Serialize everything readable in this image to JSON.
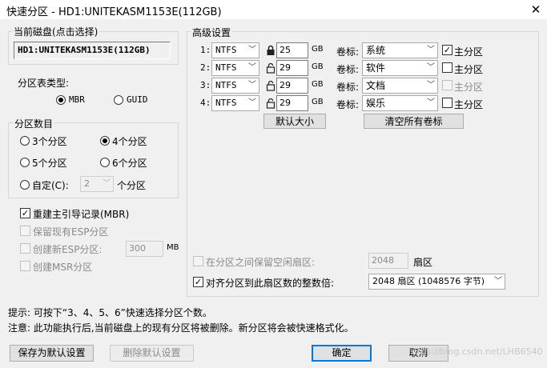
{
  "window": {
    "title": "快速分区 - HD1:UNITEKASM1153E(112GB)",
    "close_glyph": "✕"
  },
  "current_disk": {
    "group_label": "当前磁盘(点击选择)",
    "value": "HD1:UNITEKASM1153E(112GB)"
  },
  "partition_table": {
    "label": "分区表类型:",
    "options": [
      "MBR",
      "GUID"
    ],
    "selected": "MBR"
  },
  "partition_count": {
    "group_label": "分区数目",
    "options": [
      "3个分区",
      "4个分区",
      "5个分区",
      "6个分区"
    ],
    "selected": "4个分区",
    "custom_label": "自定(C):",
    "custom_value": "2",
    "custom_suffix": "个分区"
  },
  "options": {
    "rebuild_mbr": {
      "label": "重建主引导记录(MBR)",
      "checked": true,
      "enabled": true
    },
    "keep_esp": {
      "label": "保留现有ESP分区",
      "checked": false,
      "enabled": false
    },
    "create_esp": {
      "label": "创建新ESP分区:",
      "checked": false,
      "enabled": false,
      "value": "300",
      "unit": "MB"
    },
    "create_msr": {
      "label": "创建MSR分区",
      "checked": false,
      "enabled": false
    }
  },
  "advanced": {
    "group_label": "高级设置",
    "size_unit": "GB",
    "volume_label_caption": "卷标:",
    "primary_caption": "主分区",
    "rows": [
      {
        "index": "1:",
        "fs": "NTFS",
        "locked": true,
        "size": "25",
        "label": "系统",
        "primary": true,
        "primary_enabled": true
      },
      {
        "index": "2:",
        "fs": "NTFS",
        "locked": false,
        "size": "29",
        "label": "软件",
        "primary": false,
        "primary_enabled": true
      },
      {
        "index": "3:",
        "fs": "NTFS",
        "locked": false,
        "size": "29",
        "label": "文档",
        "primary": false,
        "primary_enabled": false
      },
      {
        "index": "4:",
        "fs": "NTFS",
        "locked": false,
        "size": "29",
        "label": "娱乐",
        "primary": false,
        "primary_enabled": true
      }
    ],
    "default_size_button": "默认大小",
    "clear_labels_button": "清空所有卷标",
    "reserve_gap": {
      "label": "在分区之间保留空闲扇区:",
      "checked": false,
      "enabled": false,
      "value": "2048",
      "unit": "扇区"
    },
    "align": {
      "label": "对齐分区到此扇区数的整数倍:",
      "checked": true,
      "enabled": true,
      "value": "2048 扇区 (1048576 字节)"
    }
  },
  "tips": {
    "line1": "提示: 可按下“3、4、5、6”快速选择分区个数。",
    "line2": "注意: 此功能执行后,当前磁盘上的现有分区将被删除。新分区将会被快速格式化。"
  },
  "buttons": {
    "save_default": "保存为默认设置",
    "delete_default": "删除默认设置",
    "ok": "确定",
    "cancel": "取消"
  },
  "watermark": "https://blog.csdn.net/LHB6540"
}
